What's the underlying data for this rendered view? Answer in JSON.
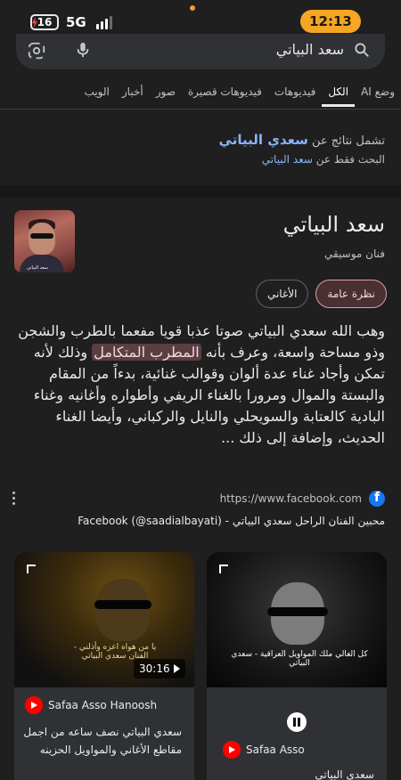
{
  "status_bar": {
    "battery": "16",
    "network": "5G",
    "time": "12:13"
  },
  "search": {
    "query": "سعد البياتي"
  },
  "tabs": [
    {
      "label": "وضع AI",
      "active": false
    },
    {
      "label": "الكل",
      "active": true
    },
    {
      "label": "فيديوهات",
      "active": false
    },
    {
      "label": "فيديوهات قصيرة",
      "active": false
    },
    {
      "label": "صور",
      "active": false
    },
    {
      "label": "أخبار",
      "active": false
    },
    {
      "label": "الويب",
      "active": false
    }
  ],
  "spell": {
    "line1_prefix": "تشمل نتائج عن",
    "line1_term": "سعدي البياتي",
    "line2_prefix": "البحث فقط عن",
    "line2_link": "سعد البياتي"
  },
  "knowledge_panel": {
    "title": "سعد البياتي",
    "subtitle": "فنان موسيقي",
    "chips": [
      {
        "label": "نظرة عامة",
        "active": true
      },
      {
        "label": "الأغاني",
        "active": false
      }
    ],
    "description_before": "وهب الله سعدي البياتي صوتا عذبا قويا مفعما بالطرب والشجن وذو مساحة واسعة، وعرف بأنه ",
    "description_highlight": "المطرب المتكامل",
    "description_after": " وذلك لأنه تمكن وأجاد غناء عدة ألوان وقوالب غنائية، بدءاً من المقام والبستة والموال ومرورا بالغناء الريفي وأطواره وأغانيه وغناء البادية كالعتابة والسويحلي والنايل والركباني، وأيضا الغناء الحديث، وإضافة إلى ذلك ...",
    "source_url": "https://www.facebook.com",
    "source_title": "محبين الفنان الراحل سعدي البياتي - Facebook (@saadialbayati)",
    "thumb_caption": "سعد البياتي"
  },
  "videos": [
    {
      "thumb_title": "يا من هواه اعزه وأذلني - الفنان سعدي البياتي",
      "duration": "30:16",
      "channel": "Safaa Asso Hanoosh",
      "title": "سعدي البياتي نصف ساعه من اجمل مقاطع الأغاني والمواويل الحزينه"
    },
    {
      "thumb_title": "كل الغالي ملك المواويل العراقية - سعدي البياتي",
      "channel": "Safaa Asso",
      "title": "سعدي البياتي"
    }
  ],
  "colors": {
    "background": "#1f1f1f",
    "link": "#8ab4f8",
    "clock_pill": "#f5a623",
    "chip_active": "#4a2f33",
    "facebook": "#1877f2",
    "youtube": "#ff0000"
  }
}
